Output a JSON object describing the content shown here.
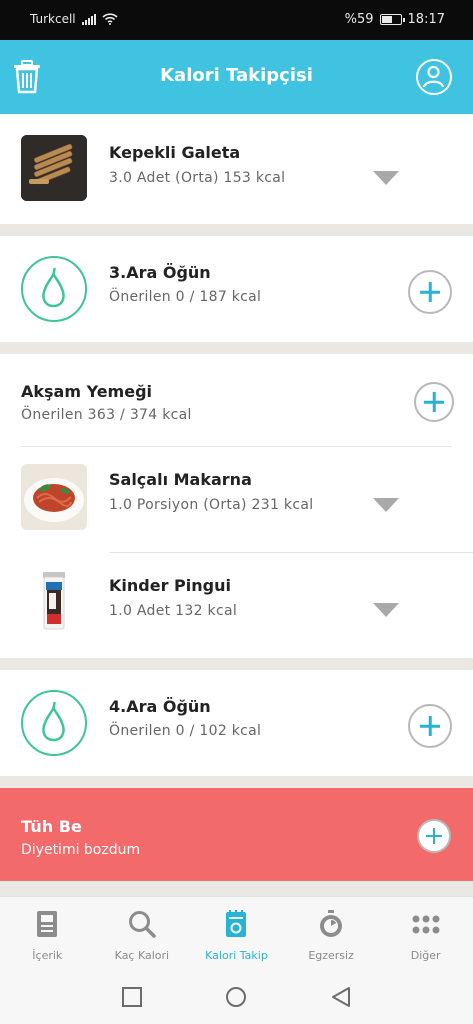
{
  "status_bar": {
    "carrier": "Turkcell",
    "battery": "%59",
    "time": "18:17"
  },
  "app_bar": {
    "title": "Kalori Takipçisi"
  },
  "food_items": [
    {
      "name": "Kepekli Galeta",
      "detail": "3.0 Adet (Orta) 153 kcal"
    },
    {
      "name": "Salçalı Makarna",
      "detail": "1.0 Porsiyon (Orta) 231 kcal"
    },
    {
      "name": "Kinder Pingui",
      "detail": "1.0 Adet 132 kcal"
    }
  ],
  "snacks": [
    {
      "title": "3.Ara Öğün",
      "sub": "Önerilen 0 / 187 kcal"
    },
    {
      "title": "4.Ara Öğün",
      "sub": "Önerilen 0 / 102 kcal"
    }
  ],
  "dinner": {
    "title": "Akşam Yemeği",
    "sub": "Önerilen 363 / 374 kcal"
  },
  "tuh_be": {
    "title": "Tüh Be",
    "sub": "Diyetimi bozdum"
  },
  "bottom_nav": [
    {
      "label": "İçerik",
      "icon": "document-icon"
    },
    {
      "label": "Kaç Kalori",
      "icon": "search-icon"
    },
    {
      "label": "Kalori Takip",
      "icon": "calorie-tracker-icon"
    },
    {
      "label": "Egzersiz",
      "icon": "stopwatch-icon"
    },
    {
      "label": "Diğer",
      "icon": "more-dots-icon"
    }
  ],
  "colors": {
    "accent": "#3fc3e0",
    "pear_green": "#3dc597",
    "tuh_red": "#f26a6a",
    "active_tab": "#27b3d3"
  }
}
